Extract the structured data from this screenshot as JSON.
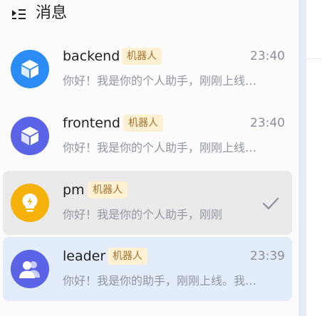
{
  "header": {
    "title": "消息"
  },
  "conversations": [
    {
      "name": "backend",
      "badge": "机器人",
      "time": "23:40",
      "preview": "你好！我是你的个人助手，刚刚上线…",
      "avatar_color": "#2b8cf5"
    },
    {
      "name": "frontend",
      "badge": "机器人",
      "time": "23:40",
      "preview": "你好！我是你的个人助手，刚刚上线…",
      "avatar_color": "#5b63e6"
    },
    {
      "name": "pm",
      "badge": "机器人",
      "time": "",
      "preview": "你好！我是你的个人助手，刚刚",
      "avatar_color": "#f6b20a",
      "selected": true
    },
    {
      "name": "leader",
      "badge": "机器人",
      "time": "23:39",
      "preview": "你好！我是你的助手，刚刚上线。我…",
      "avatar_color": "#5b63e6"
    }
  ],
  "colors": {
    "badge_bg": "#fdf0d3",
    "badge_text": "#a4712a",
    "selected_row": "#eaeaea",
    "active_row": "#e3ecfb"
  }
}
